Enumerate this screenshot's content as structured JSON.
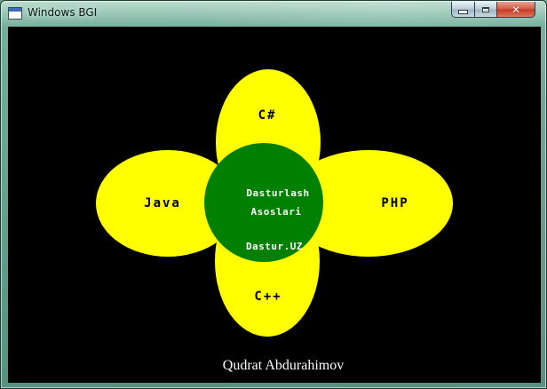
{
  "window": {
    "title": "Windows BGI"
  },
  "canvas": {
    "background_color": "#000000",
    "petal_color": "#ffff00",
    "center_color": "#008000",
    "petals": {
      "top": "C#",
      "left": "Java",
      "right": "PHP",
      "bottom": "C++"
    },
    "center": {
      "line1": "Dasturlash",
      "line2": "Asoslari",
      "line3": "Dastur.UZ"
    },
    "author": "Qudrat Abdurahimov"
  }
}
